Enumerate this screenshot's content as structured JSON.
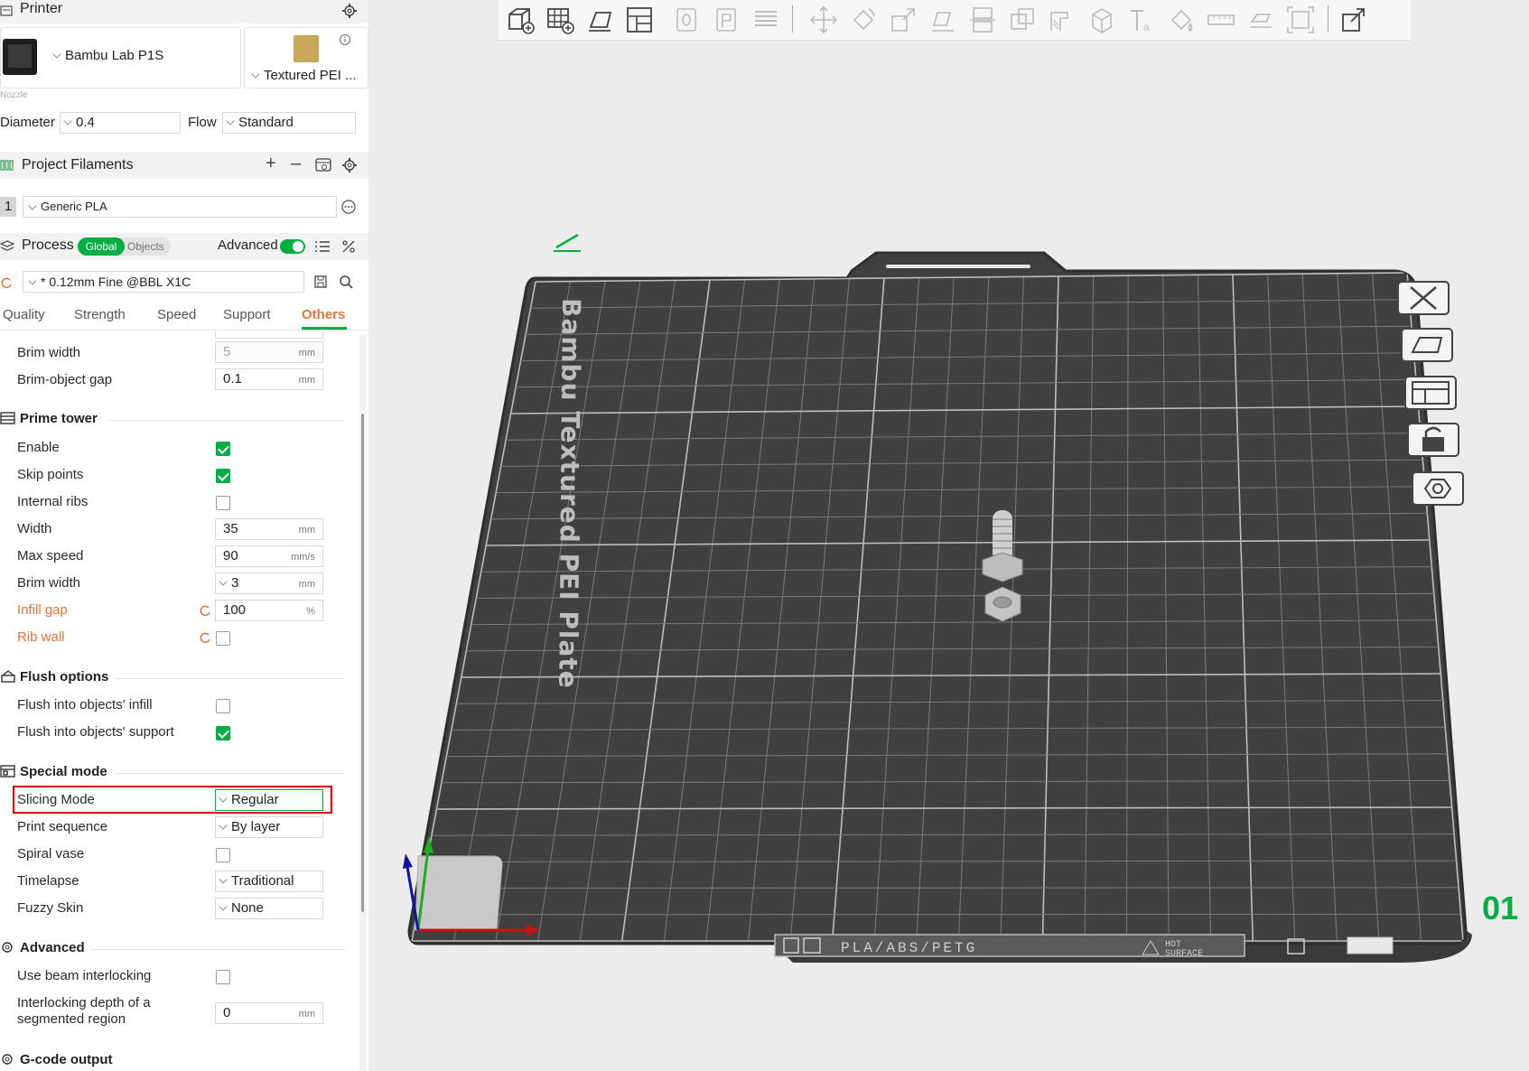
{
  "printer": {
    "header": "Printer",
    "name": "Bambu Lab P1S",
    "plate": "Textured PEI ...",
    "nozzle_label": "Nozzle",
    "diameter_label": "Diameter",
    "diameter_value": "0.4",
    "flow_label": "Flow",
    "flow_value": "Standard"
  },
  "filaments": {
    "header": "Project Filaments",
    "items": [
      {
        "index": "1",
        "name": "Generic PLA"
      }
    ]
  },
  "process": {
    "header": "Process",
    "toggle_global": "Global",
    "toggle_objects": "Objects",
    "advanced_label": "Advanced",
    "advanced_on": true,
    "preset": "* 0.12mm Fine @BBL X1C",
    "tabs": [
      "Quality",
      "Strength",
      "Speed",
      "Support",
      "Others"
    ],
    "active_tab": "Others"
  },
  "settings": {
    "brim_width_label": "Brim width",
    "brim_width_value": "5",
    "brim_gap_label": "Brim-object gap",
    "brim_gap_value": "0.1",
    "unit_mm": "mm",
    "unit_mms": "mm/s",
    "unit_pct": "%",
    "prime_tower": {
      "title": "Prime tower",
      "enable_label": "Enable",
      "enable": true,
      "skip_label": "Skip points",
      "skip": true,
      "ribs_label": "Internal ribs",
      "ribs": false,
      "width_label": "Width",
      "width": "35",
      "speed_label": "Max speed",
      "speed": "90",
      "brim_label": "Brim width",
      "brim": "3",
      "infill_gap_label": "Infill gap",
      "infill_gap": "100",
      "rib_wall_label": "Rib wall",
      "rib_wall": false
    },
    "flush": {
      "title": "Flush options",
      "infill_label": "Flush into objects' infill",
      "infill": false,
      "support_label": "Flush into objects' support",
      "support": true
    },
    "special": {
      "title": "Special mode",
      "slicing_label": "Slicing Mode",
      "slicing": "Regular",
      "sequence_label": "Print sequence",
      "sequence": "By layer",
      "spiral_label": "Spiral vase",
      "spiral": false,
      "timelapse_label": "Timelapse",
      "timelapse": "Traditional",
      "fuzzy_label": "Fuzzy Skin",
      "fuzzy": "None"
    },
    "advanced": {
      "title": "Advanced",
      "beam_label": "Use beam interlocking",
      "beam": false,
      "depth_label": "Interlocking depth of a",
      "depth_label2": "segmented region",
      "depth": "0"
    },
    "gcode_title": "G-code output"
  },
  "viewport": {
    "plate_label": "Bambu Textured PEI Plate",
    "plate_number": "01",
    "plate_tag_materials": "PLA/ABS/PETG",
    "plate_tag_hot": "HOT",
    "plate_tag_surface": "SURFACE"
  },
  "colors": {
    "accent": "#00ae42",
    "modified": "#e8733a",
    "highlight": "#e00000",
    "plate": "#3b3b3b"
  }
}
